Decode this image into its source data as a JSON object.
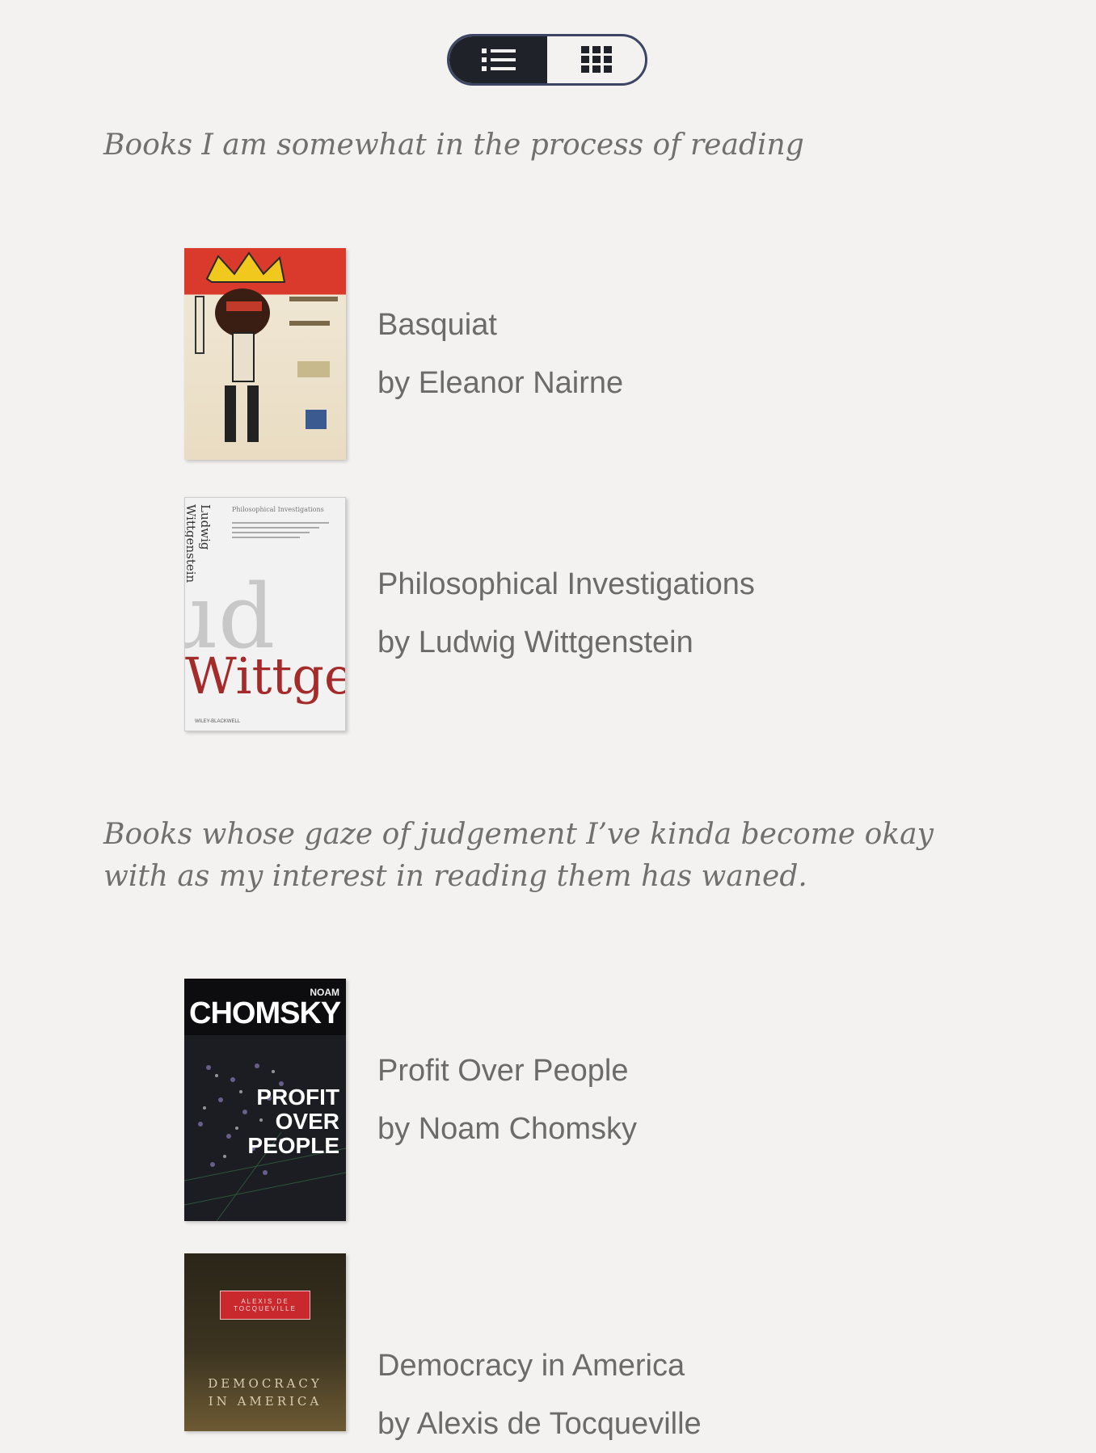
{
  "view_toggle": {
    "list_icon": "list-icon",
    "grid_icon": "grid-icon",
    "active": "list"
  },
  "sections": [
    {
      "heading": "Books I am somewhat in the process of reading",
      "books": [
        {
          "title": "Basquiat",
          "author": "by Eleanor Nairne"
        },
        {
          "title": "Philosophical Investigations",
          "author": "by Ludwig Wittgenstein"
        }
      ]
    },
    {
      "heading": "Books whose gaze of judgement I’ve kinda become okay with as my interest in reading them has waned.",
      "books": [
        {
          "title": "Profit Over People",
          "author": "by Noam Chomsky"
        },
        {
          "title": "Democracy in America",
          "author": "by Alexis de Tocqueville"
        }
      ]
    }
  ],
  "covers": {
    "wittgenstein": {
      "author": "Ludwig Wittgenstein",
      "big_text": "Wittge",
      "small_title": "Philosophical Investigations",
      "publisher": "WILEY-BLACKWELL"
    },
    "chomsky": {
      "author_top": "NOAM",
      "author_name": "CHOMSKY",
      "title_lines": [
        "PROFIT",
        "OVER",
        "PEOPLE"
      ]
    },
    "democracy": {
      "label": "ALEXIS DE TOCQUEVILLE",
      "title_lines": [
        "DEMOCRACY",
        "IN AMERICA"
      ]
    }
  }
}
